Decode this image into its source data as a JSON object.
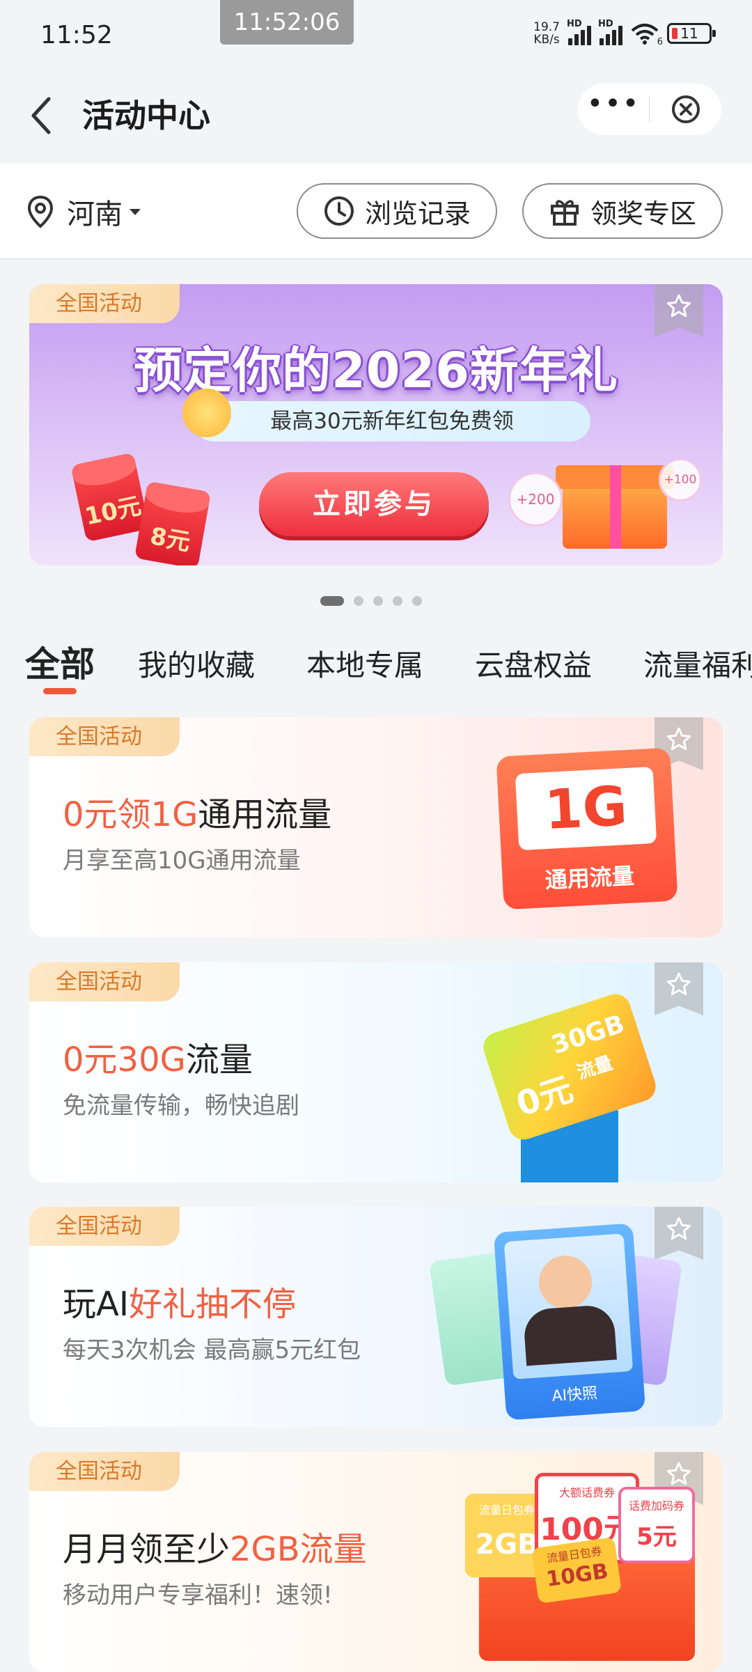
{
  "status_bar": {
    "time": "11:52",
    "clock_pill": "11:52:06",
    "net_speed_value": "19.7",
    "net_speed_unit": "KB/s",
    "hd1": "HD",
    "hd2": "HD",
    "wifi_sub": "6",
    "battery": "11"
  },
  "header": {
    "title": "活动中心",
    "back_icon": "chevron-left-icon",
    "more_icon": "more-horizontal-icon",
    "close_icon": "close-circle-icon"
  },
  "filter_bar": {
    "location": "河南",
    "history_label": "浏览记录",
    "prize_label": "领奖专区"
  },
  "banner": {
    "tag": "全国活动",
    "headline": "预定你的2026新年礼",
    "subline": "最高30元新年红包免费领",
    "button": "立即参与",
    "redpack_1": "10元",
    "redpack_2": "8元",
    "bubble_1": "+200",
    "bubble_2": "+100",
    "pages": 5,
    "active_page": 1
  },
  "tabs": [
    "全部",
    "我的收藏",
    "本地专属",
    "云盘权益",
    "流量福利"
  ],
  "active_tab": 0,
  "cards": [
    {
      "tag": "全国活动",
      "title_highlight": "0元领1G",
      "title_rest": "通用流量",
      "desc": "月享至高10G通用流量",
      "image_text_big": "1G",
      "image_text_label": "通用流量"
    },
    {
      "tag": "全国活动",
      "title_highlight": "0元30G",
      "title_rest": "流量",
      "desc": "免流量传输，畅快追剧",
      "image_zero": "0元",
      "image_gb": "30GB",
      "image_label": "流量"
    },
    {
      "tag": "全国活动",
      "title_prefix": "玩AI",
      "title_highlight": "好礼抽不停",
      "desc": "每天3次机会 最高赢5元红包",
      "image_label": "AI快照"
    },
    {
      "tag": "全国活动",
      "title_prefix": "月月领至少",
      "title_highlight": "2GB流量",
      "desc": "移动用户专享福利！速领!",
      "coupon_1_mini": "流量日包券",
      "coupon_1": "2GB",
      "coupon_2_mini": "大额话费券",
      "coupon_2": "100元",
      "coupon_3_mini": "话费加码券",
      "coupon_3": "5元",
      "coupon_4_mini": "流量日包券",
      "coupon_4": "10GB"
    }
  ],
  "colors": {
    "accent": "#f26042",
    "tag_text": "#d87a2a",
    "button_red": "#ee2f3c"
  }
}
